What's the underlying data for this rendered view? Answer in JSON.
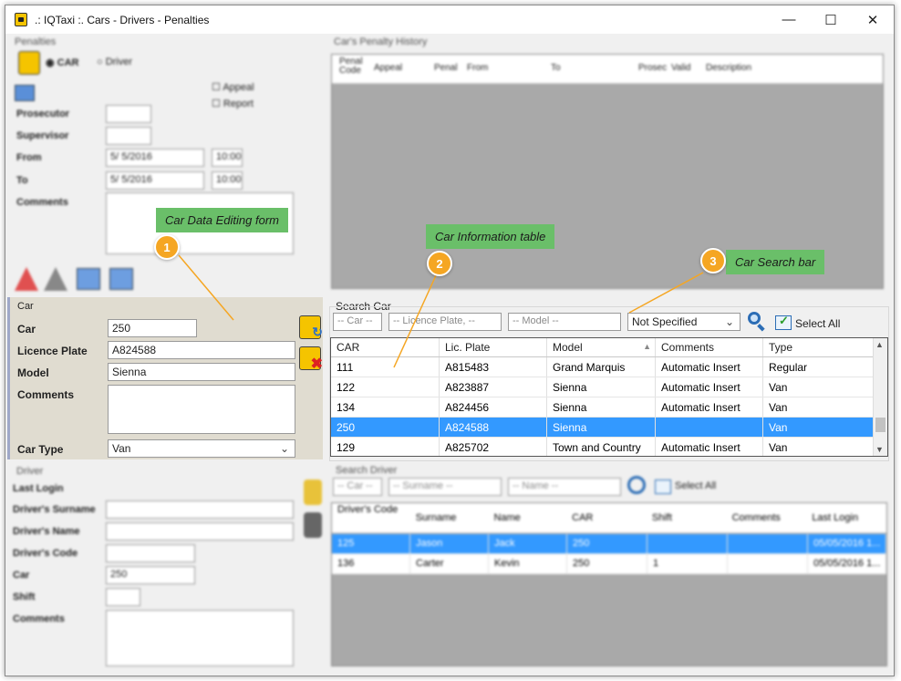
{
  "window": {
    "title": ".: IQTaxi :.  Cars - Drivers - Penalties"
  },
  "penalties": {
    "group_label": "Penalties",
    "radio_car": "CAR",
    "radio_driver": "Driver",
    "appeal_label": "Appeal",
    "report_label": "Report",
    "prosecutor_label": "Prosecutor",
    "supervisor_label": "Supervisor",
    "from_label": "From",
    "to_label": "To",
    "comments_label": "Comments",
    "from_date": "5/ 5/2016",
    "to_date": "5/ 5/2016",
    "from_time": "10:00",
    "to_time": "10:00"
  },
  "history": {
    "group_label": "Car's Penalty History",
    "columns": [
      "Penal Code",
      "Appeal",
      "Penal",
      "From",
      "To",
      "Prosec",
      "Valid",
      "Description"
    ]
  },
  "car_form": {
    "group_label": "Car",
    "car_label": "Car",
    "car_value": "250",
    "plate_label": "Licence Plate",
    "plate_value": "A824588",
    "model_label": "Model",
    "model_value": "Sienna",
    "comments_label": "Comments",
    "comments_value": "",
    "type_label": "Car Type",
    "type_value": "Van"
  },
  "search_car": {
    "group_label": "Search Car",
    "car_placeholder": "-- Car --",
    "plate_placeholder": "-- Licence Plate, --",
    "model_placeholder": "-- Model --",
    "type_select": "Not Specified",
    "select_all": "Select All"
  },
  "car_table": {
    "columns": [
      "CAR",
      "Lic. Plate",
      "Model",
      "Comments",
      "Type"
    ],
    "rows": [
      [
        "111",
        "A815483",
        "Grand Marquis",
        "Automatic Insert",
        "Regular"
      ],
      [
        "122",
        "A823887",
        "Sienna",
        "Automatic Insert",
        "Van"
      ],
      [
        "134",
        "A824456",
        "Sienna",
        "Automatic Insert",
        "Van"
      ],
      [
        "250",
        "A824588",
        "Sienna",
        "",
        "Van"
      ],
      [
        "129",
        "A825702",
        "Town and Country",
        "Automatic Insert",
        "Van"
      ]
    ],
    "selected_index": 3
  },
  "driver": {
    "group_label": "Driver",
    "last_login_label": "Last Login",
    "surname_label": "Driver's Surname",
    "name_label": "Driver's Name",
    "code_label": "Driver's Code",
    "car_label": "Car",
    "car_value": "250",
    "shift_label": "Shift",
    "comments_label": "Comments"
  },
  "search_driver": {
    "group_label": "Search Driver",
    "car_placeholder": "-- Car --",
    "surname_placeholder": "-- Surname --",
    "name_placeholder": "-- Name --",
    "select_all": "Select All",
    "columns": [
      "Driver's Code",
      "Surname",
      "Name",
      "CAR",
      "Shift",
      "Comments",
      "Last Login"
    ],
    "rows": [
      [
        "125",
        "Jason",
        "Jack",
        "250",
        "",
        "",
        "05/05/2016 1..."
      ],
      [
        "136",
        "Carter",
        "Kevin",
        "250",
        "1",
        "",
        "05/05/2016 1..."
      ]
    ]
  },
  "callouts": {
    "c1_num": "1",
    "c1_text": "Car Data Editing form",
    "c2_num": "2",
    "c2_text": "Car Information table",
    "c3_num": "3",
    "c3_text": "Car Search bar"
  },
  "colors": {
    "accent": "#3399ff",
    "callout": "#6abf69",
    "badge": "#f5a623"
  }
}
